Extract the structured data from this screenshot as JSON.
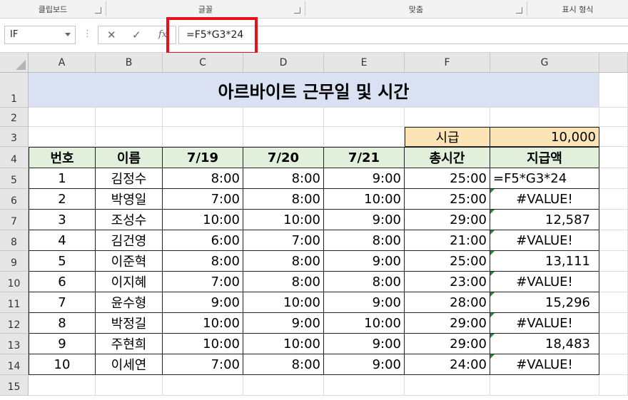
{
  "ribbon": {
    "groups": [
      "클립보드",
      "글꼴",
      "맞춤",
      "표시 형식"
    ]
  },
  "formula_bar": {
    "name_box": "IF",
    "cancel_icon": "✕",
    "enter_icon": "✓",
    "fx_label": "fx",
    "formula": "=F5*G3*24"
  },
  "columns": [
    "A",
    "B",
    "C",
    "D",
    "E",
    "F",
    "G"
  ],
  "rows": [
    "1",
    "2",
    "3",
    "4",
    "5",
    "6",
    "7",
    "8",
    "9",
    "10",
    "11",
    "12",
    "13",
    "14",
    "15"
  ],
  "sheet": {
    "title": "아르바이트 근무일 및 시간",
    "wage_label": "시급",
    "wage_value": "10,000",
    "headers": [
      "번호",
      "이름",
      "7/19",
      "7/20",
      "7/21",
      "총시간",
      "지급액"
    ],
    "data": [
      [
        "1",
        "김정수",
        "8:00",
        "8:00",
        "9:00",
        "25:00",
        "=F5*G3*24"
      ],
      [
        "2",
        "박영일",
        "7:00",
        "8:00",
        "10:00",
        "25:00",
        "#VALUE!"
      ],
      [
        "3",
        "조성수",
        "10:00",
        "10:00",
        "9:00",
        "29:00",
        "12,587"
      ],
      [
        "4",
        "김건영",
        "6:00",
        "7:00",
        "8:00",
        "21:00",
        "#VALUE!"
      ],
      [
        "5",
        "이준혁",
        "8:00",
        "8:00",
        "9:00",
        "25:00",
        "13,111"
      ],
      [
        "6",
        "이지혜",
        "7:00",
        "8:00",
        "8:00",
        "23:00",
        "#VALUE!"
      ],
      [
        "7",
        "윤수형",
        "9:00",
        "10:00",
        "9:00",
        "28:00",
        "15,296"
      ],
      [
        "8",
        "박정길",
        "10:00",
        "9:00",
        "10:00",
        "29:00",
        "#VALUE!"
      ],
      [
        "9",
        "주현희",
        "10:00",
        "10:00",
        "9:00",
        "29:00",
        "18,483"
      ],
      [
        "10",
        "이세연",
        "7:00",
        "8:00",
        "9:00",
        "24:00",
        "#VALUE!"
      ]
    ]
  },
  "colors": {
    "title_fill": "#d9e1f2",
    "header_fill": "#e2efda",
    "wage_fill": "#fce4b6",
    "highlight": "#e8101a"
  }
}
